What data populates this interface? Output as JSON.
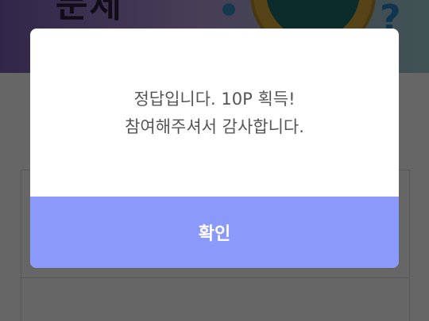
{
  "background": {
    "banner_title": "문제",
    "banner_icon": "question-mark-icon",
    "banner_icon_glyph": "?"
  },
  "dialog": {
    "message_line1": "정답입니다. 10P 획득!",
    "message_line2": "참여해주셔서 감사합니다.",
    "confirm_label": "확인",
    "button_color": "#8b99fb"
  }
}
